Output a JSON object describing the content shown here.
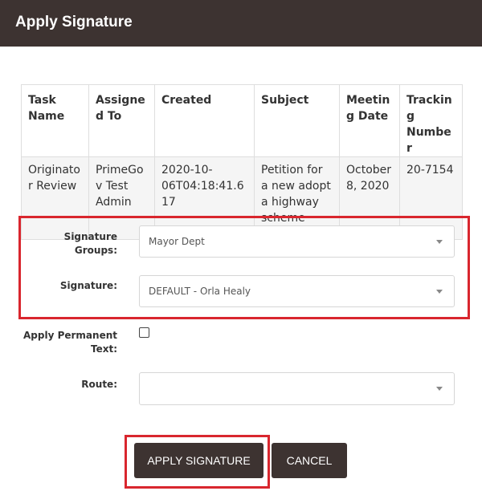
{
  "dialog": {
    "title": "Apply Signature"
  },
  "task_table": {
    "headers": [
      "Task Name",
      "Assigned To",
      "Created",
      "Subject",
      "Meeting Date",
      "Tracking Number"
    ],
    "rows": [
      [
        "Originator Review",
        "PrimeGov Test Admin",
        "2020-10-06T04:18:41.617",
        "Petition for a new adopt a highway scheme",
        "October 8, 2020",
        "20-7154"
      ]
    ]
  },
  "form": {
    "signature_groups": {
      "label": "Signature Groups:",
      "value": "Mayor Dept"
    },
    "signature": {
      "label": "Signature:",
      "value": "DEFAULT - Orla Healy"
    },
    "apply_permanent_text": {
      "label": "Apply Permanent Text:",
      "checked": false
    },
    "route": {
      "label": "Route:",
      "value": ""
    }
  },
  "buttons": {
    "apply": "APPLY SIGNATURE",
    "cancel": "CANCEL"
  },
  "colors": {
    "header_bg": "#3d3331",
    "button_bg": "#3d3331",
    "highlight": "#d9262e"
  }
}
